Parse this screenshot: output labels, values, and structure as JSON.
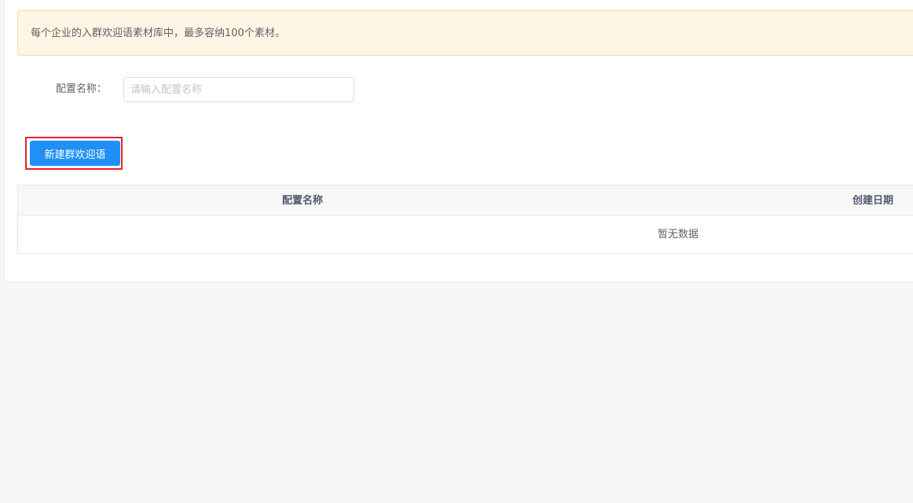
{
  "notice": {
    "text": "每个企业的入群欢迎语素材库中，最多容纳100个素材。"
  },
  "filter": {
    "label": "配置名称：",
    "placeholder": "请输入配置名称",
    "value": ""
  },
  "toolbar": {
    "new_button_label": "新建群欢迎语",
    "highlight_color": "#e8212c",
    "primary_color": "#1e90f6"
  },
  "table": {
    "columns": [
      "配置名称",
      "创建日期"
    ],
    "rows": [],
    "empty_text": "暂无数据"
  }
}
